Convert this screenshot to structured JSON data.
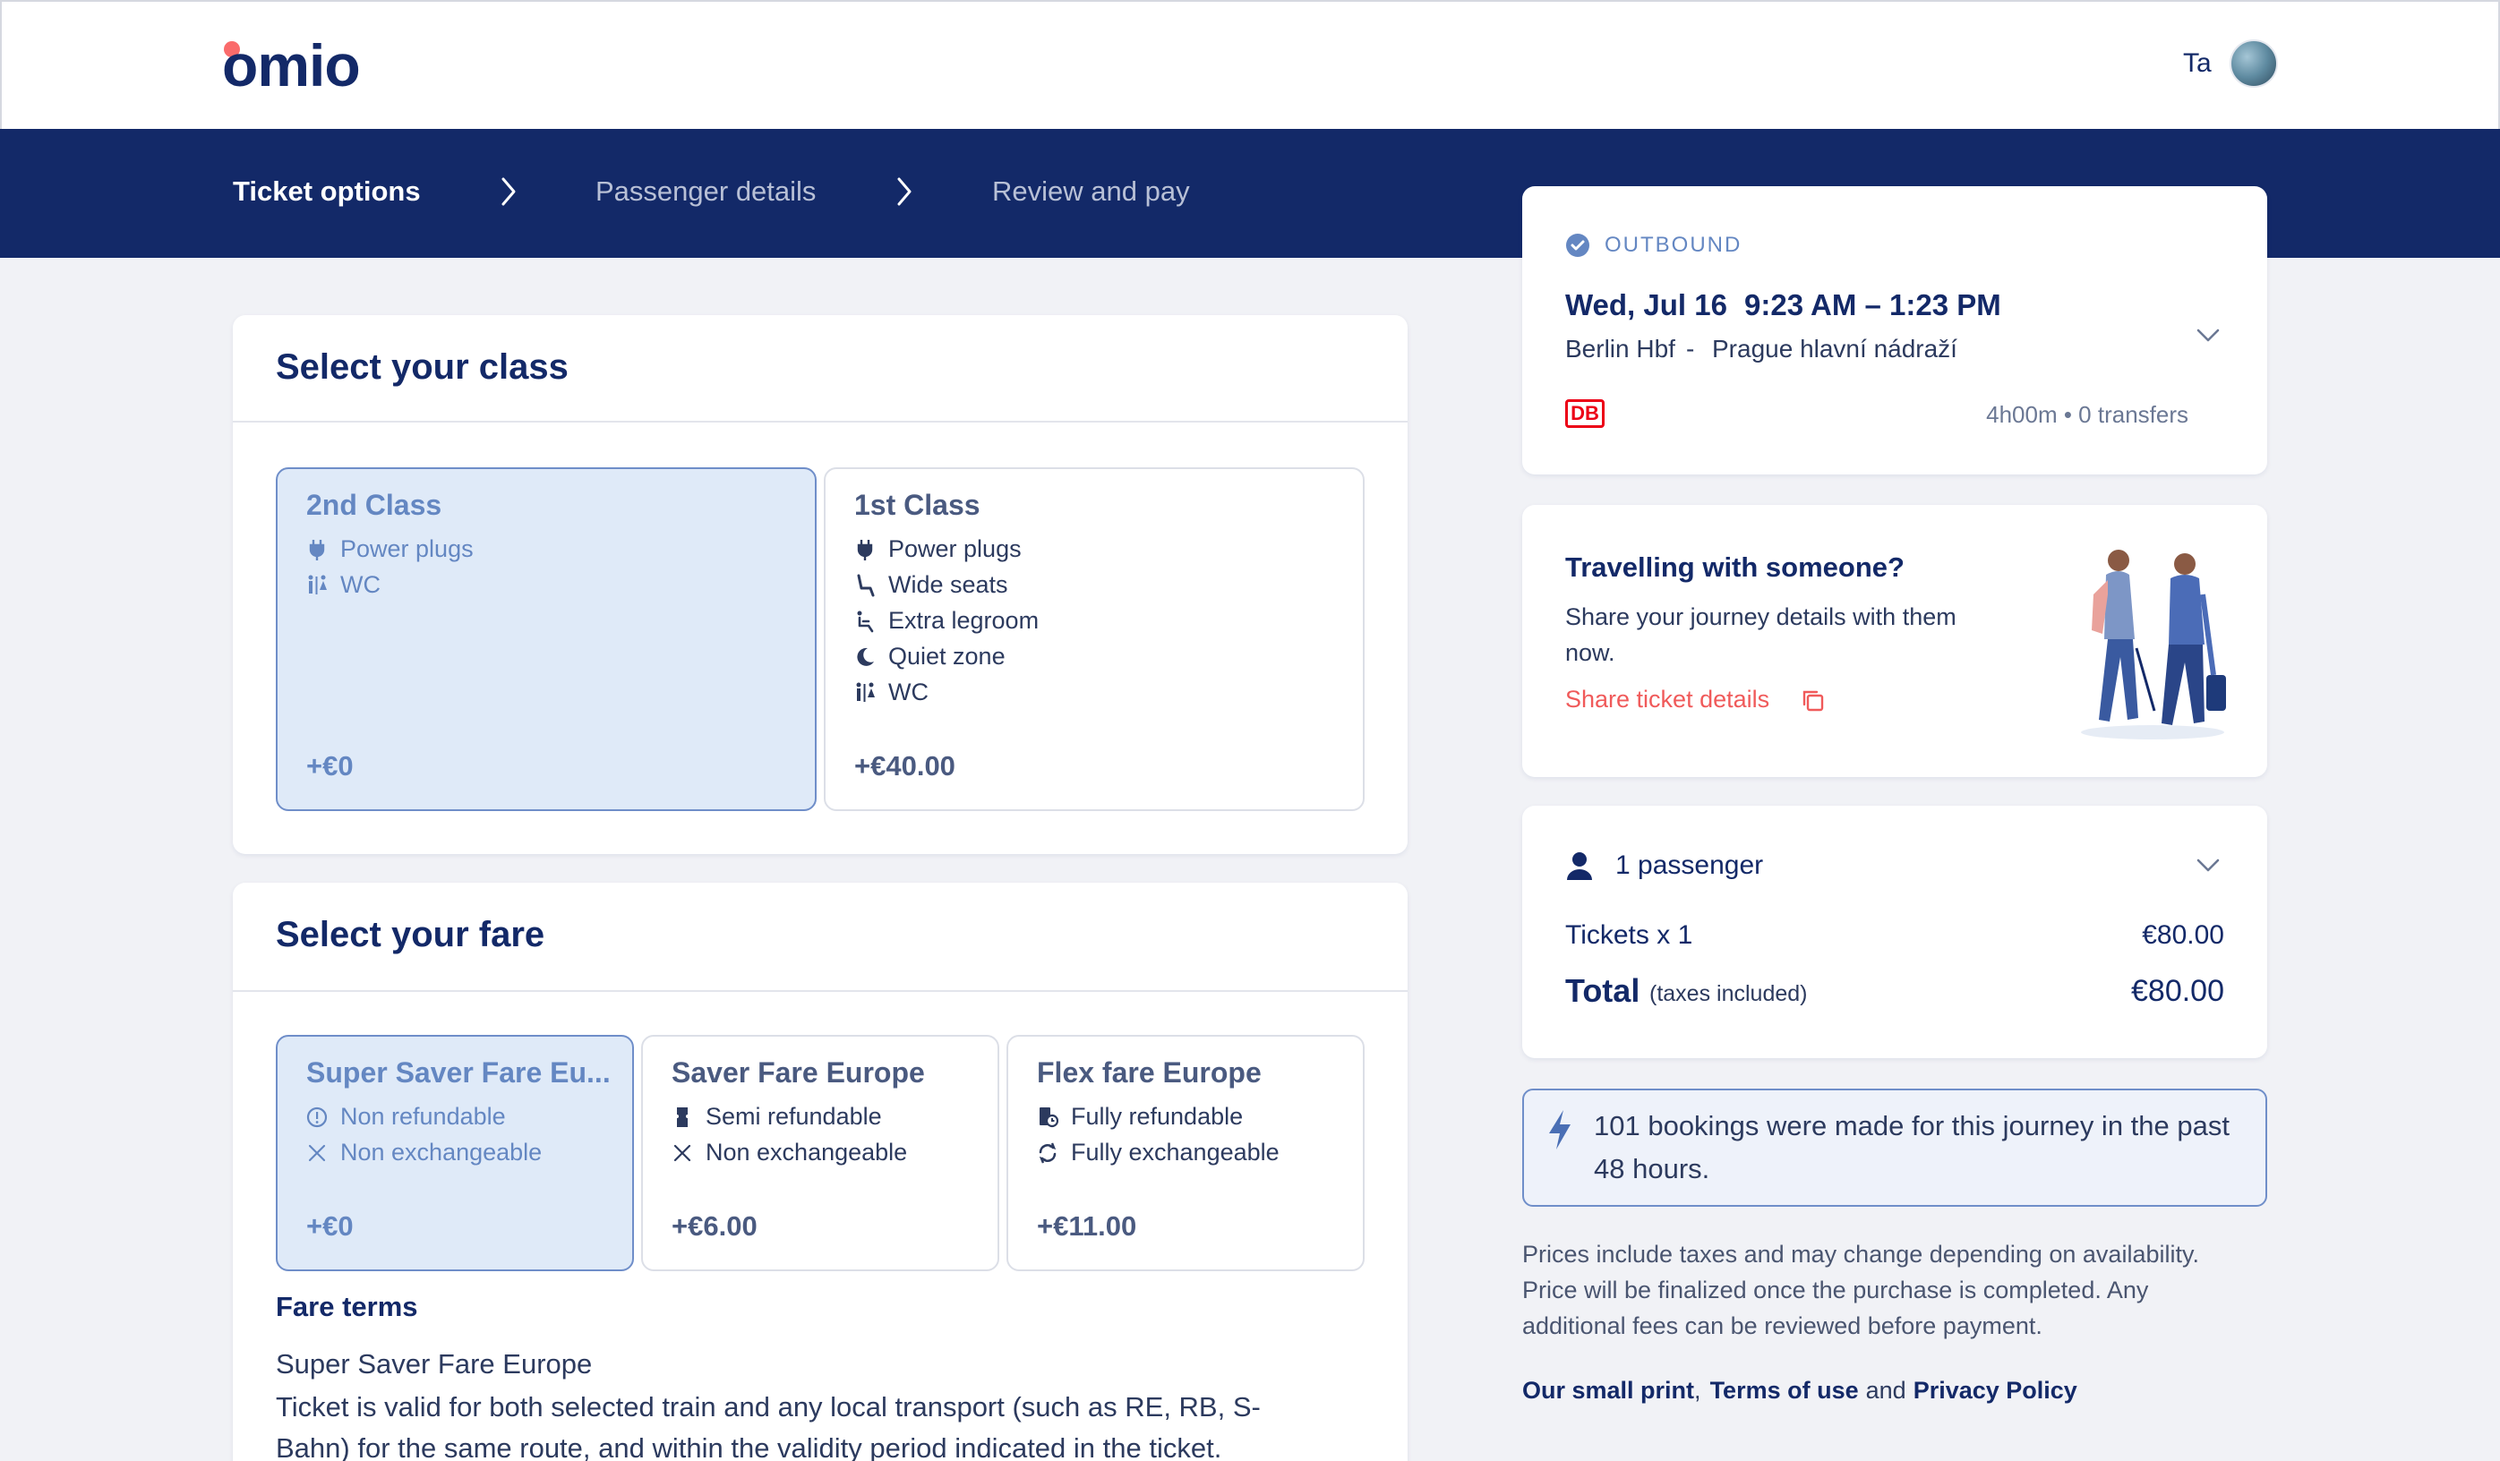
{
  "header": {
    "logo_text": "omio",
    "user_initials": "Ta"
  },
  "stepper": {
    "steps": [
      "Ticket options",
      "Passenger details",
      "Review and pay"
    ]
  },
  "class_section": {
    "title": "Select your class",
    "options": [
      {
        "name": "2nd Class",
        "features": [
          "Power plugs",
          "WC"
        ],
        "price": "+€0",
        "selected": true
      },
      {
        "name": "1st Class",
        "features": [
          "Power plugs",
          "Wide seats",
          "Extra legroom",
          "Quiet zone",
          "WC"
        ],
        "price": "+€40.00",
        "selected": false
      }
    ]
  },
  "fare_section": {
    "title": "Select your fare",
    "options": [
      {
        "name": "Super Saver Fare Eu...",
        "features": [
          "Non refundable",
          "Non exchangeable"
        ],
        "price": "+€0",
        "selected": true
      },
      {
        "name": "Saver Fare Europe",
        "features": [
          "Semi refundable",
          "Non exchangeable"
        ],
        "price": "+€6.00",
        "selected": false
      },
      {
        "name": "Flex fare Europe",
        "features": [
          "Fully refundable",
          "Fully exchangeable"
        ],
        "price": "+€11.00",
        "selected": false
      }
    ],
    "terms_heading": "Fare terms",
    "terms_name": "Super Saver Fare Europe",
    "terms_line1": "Ticket is valid for both selected train and any local transport (such as RE, RB, S-",
    "terms_line2": "Bahn) for the same route, and within the validity period indicated in the ticket."
  },
  "journey": {
    "label": "OUTBOUND",
    "date": "Wed, Jul 16",
    "times": "9:23 AM – 1:23 PM",
    "from": "Berlin Hbf",
    "separator": "-",
    "to": "Prague hlavní nádraží",
    "operator": "DB",
    "duration": "4h00m • 0 transfers"
  },
  "share": {
    "title": "Travelling with someone?",
    "text_line1": "Share your journey details with them",
    "text_line2": "now.",
    "link": "Share ticket details"
  },
  "summary": {
    "passengers": "1 passenger",
    "tickets_label": "Tickets x 1",
    "tickets_value": "€80.00",
    "total_label": "Total",
    "total_note": "(taxes included)",
    "total_value": "€80.00"
  },
  "notice": {
    "line1": "101 bookings were made for this journey in the past",
    "line2": "48 hours."
  },
  "disclaimer": {
    "line1": "Prices include taxes and may change depending on availability.",
    "line2": "Price will be finalized once the purchase is completed. Any",
    "line3": "additional fees can be reviewed before payment."
  },
  "footer_links": {
    "small_print": "Our small print",
    "comma": ",",
    "terms": "Terms of use",
    "and": "and",
    "privacy": "Privacy Policy"
  },
  "colors": {
    "brand_navy": "#132968",
    "accent_coral": "#fa6b6b",
    "selected_bg": "#dfeaf8",
    "selected_text": "#6487c2",
    "db_red": "#ec0016"
  }
}
